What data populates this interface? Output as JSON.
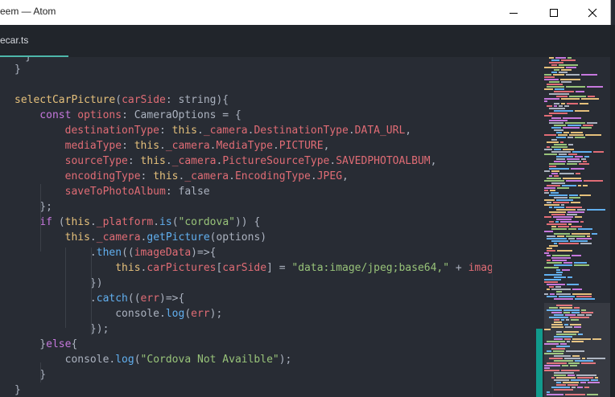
{
  "window": {
    "title": "eem — Atom",
    "buttons": [
      "minimize",
      "maximize",
      "close"
    ]
  },
  "tabs": [
    {
      "label": "ecar.ts",
      "active": true
    }
  ],
  "editor": {
    "lines": [
      [
        [
          "}",
          "n"
        ]
      ],
      [],
      [
        [
          "selectCarPicture",
          "y"
        ],
        [
          "(",
          "n"
        ],
        [
          "carSide",
          "p"
        ],
        [
          ": string){",
          "n"
        ]
      ],
      [
        [
          "    const ",
          "k"
        ],
        [
          "options",
          "p"
        ],
        [
          ": CameraOptions = {",
          "n"
        ]
      ],
      [
        [
          "        destinationType",
          "p"
        ],
        [
          ": ",
          "n"
        ],
        [
          "this",
          "y"
        ],
        [
          ".",
          "n"
        ],
        [
          "_camera",
          "p"
        ],
        [
          ".",
          "n"
        ],
        [
          "DestinationType",
          "p"
        ],
        [
          ".",
          "n"
        ],
        [
          "DATA_URL",
          "p"
        ],
        [
          ",",
          "n"
        ]
      ],
      [
        [
          "        mediaType",
          "p"
        ],
        [
          ": ",
          "n"
        ],
        [
          "this",
          "y"
        ],
        [
          ".",
          "n"
        ],
        [
          "_camera",
          "p"
        ],
        [
          ".",
          "n"
        ],
        [
          "MediaType",
          "p"
        ],
        [
          ".",
          "n"
        ],
        [
          "PICTURE",
          "p"
        ],
        [
          ",",
          "n"
        ]
      ],
      [
        [
          "        sourceType",
          "p"
        ],
        [
          ": ",
          "n"
        ],
        [
          "this",
          "y"
        ],
        [
          ".",
          "n"
        ],
        [
          "_camera",
          "p"
        ],
        [
          ".",
          "n"
        ],
        [
          "PictureSourceType",
          "p"
        ],
        [
          ".",
          "n"
        ],
        [
          "SAVEDPHOTOALBUM",
          "p"
        ],
        [
          ",",
          "n"
        ]
      ],
      [
        [
          "        encodingType",
          "p"
        ],
        [
          ": ",
          "n"
        ],
        [
          "this",
          "y"
        ],
        [
          ".",
          "n"
        ],
        [
          "_camera",
          "p"
        ],
        [
          ".",
          "n"
        ],
        [
          "EncodingType",
          "p"
        ],
        [
          ".",
          "n"
        ],
        [
          "JPEG",
          "p"
        ],
        [
          ",",
          "n"
        ]
      ],
      [
        [
          "        saveToPhotoAlbum",
          "p"
        ],
        [
          ": false",
          "n"
        ]
      ],
      [
        [
          "    };",
          "n"
        ]
      ],
      [
        [
          "    if",
          "k"
        ],
        [
          " (",
          "n"
        ],
        [
          "this",
          "y"
        ],
        [
          ".",
          "n"
        ],
        [
          "_platform",
          "p"
        ],
        [
          ".",
          "n"
        ],
        [
          "is",
          "f"
        ],
        [
          "(",
          "n"
        ],
        [
          "\"cordova\"",
          "s"
        ],
        [
          ")) {",
          "n"
        ]
      ],
      [
        [
          "        this",
          "y"
        ],
        [
          ".",
          "n"
        ],
        [
          "_camera",
          "p"
        ],
        [
          ".",
          "n"
        ],
        [
          "getPicture",
          "f"
        ],
        [
          "(options)",
          "n"
        ]
      ],
      [
        [
          "            .",
          "n"
        ],
        [
          "then",
          "f"
        ],
        [
          "((",
          "n"
        ],
        [
          "imageData",
          "p"
        ],
        [
          ")=>{",
          "n"
        ]
      ],
      [
        [
          "                this",
          "y"
        ],
        [
          ".",
          "n"
        ],
        [
          "carPictures",
          "p"
        ],
        [
          "[",
          "n"
        ],
        [
          "carSide",
          "p"
        ],
        [
          "] = ",
          "n"
        ],
        [
          "\"data:image/jpeg;base64,\"",
          "s"
        ],
        [
          " + ",
          "n"
        ],
        [
          "imageData",
          "p"
        ],
        [
          ";",
          "n"
        ]
      ],
      [
        [
          "            })",
          "n"
        ]
      ],
      [
        [
          "            .",
          "n"
        ],
        [
          "catch",
          "f"
        ],
        [
          "((",
          "n"
        ],
        [
          "err",
          "p"
        ],
        [
          ")=>{",
          "n"
        ]
      ],
      [
        [
          "                console",
          "n"
        ],
        [
          ".",
          "n"
        ],
        [
          "log",
          "f"
        ],
        [
          "(",
          "n"
        ],
        [
          "err",
          "p"
        ],
        [
          ");",
          "n"
        ]
      ],
      [
        [
          "            });",
          "n"
        ]
      ],
      [
        [
          "    }",
          "n"
        ],
        [
          "else",
          "k"
        ],
        [
          "{",
          "n"
        ]
      ],
      [
        [
          "        console",
          "n"
        ],
        [
          ".",
          "n"
        ],
        [
          "log",
          "f"
        ],
        [
          "(",
          "n"
        ],
        [
          "\"Cordova Not Availble\"",
          "s"
        ],
        [
          ");",
          "n"
        ]
      ],
      [
        [
          "    }",
          "n"
        ]
      ],
      [
        [
          "}",
          "n"
        ]
      ]
    ]
  },
  "colors": {
    "keyword": "#c678dd",
    "function": "#61afef",
    "property": "#e06c75",
    "string": "#98c379",
    "type": "#e5c07b",
    "plain": "#abb2bf",
    "accent": "#4eb7aa",
    "scroll_thumb": "#119a8c",
    "background": "#282c34",
    "tabbar": "#21252b"
  }
}
